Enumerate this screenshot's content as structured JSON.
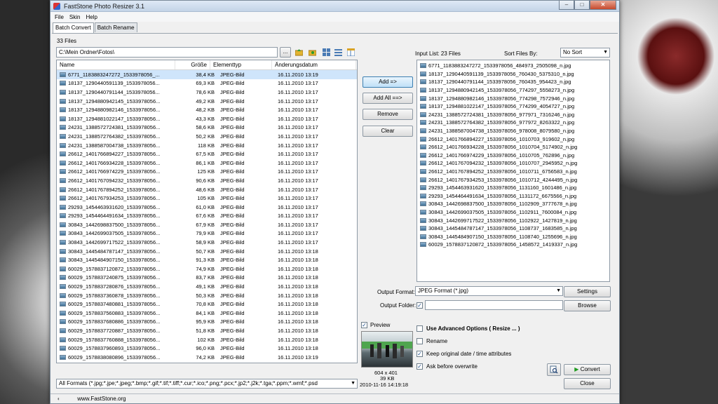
{
  "window": {
    "title": "FastStone Photo Resizer 3.1"
  },
  "menu": [
    "File",
    "Skin",
    "Help"
  ],
  "tabs": [
    "Batch Convert",
    "Batch Rename"
  ],
  "left": {
    "file_count": "33 Files",
    "path": "C:\\Mein Ordner\\Fotos\\",
    "browse_label": "...",
    "columns": [
      "Name",
      "Größe",
      "Elementtyp",
      "Änderungsdatum"
    ],
    "files": [
      [
        "6771_1183883247272_1533978056_...",
        "38,4 KB",
        "JPEG-Bild",
        "16.11.2010 13:19"
      ],
      [
        "18137_1290440591139_1533978056...",
        "69,3 KB",
        "JPEG-Bild",
        "16.11.2010 13:17"
      ],
      [
        "18137_1290440791144_1533978056...",
        "78,6 KB",
        "JPEG-Bild",
        "16.11.2010 13:17"
      ],
      [
        "18137_1294880942145_1533978056...",
        "49,2 KB",
        "JPEG-Bild",
        "16.11.2010 13:17"
      ],
      [
        "18137_1294880982146_1533978056...",
        "48,2 KB",
        "JPEG-Bild",
        "16.11.2010 13:17"
      ],
      [
        "18137_1294881022147_1533978056...",
        "43,3 KB",
        "JPEG-Bild",
        "16.11.2010 13:17"
      ],
      [
        "24231_1388572724381_1533978056...",
        "58,6 KB",
        "JPEG-Bild",
        "16.11.2010 13:17"
      ],
      [
        "24231_1388572764382_1533978056...",
        "50,2 KB",
        "JPEG-Bild",
        "16.11.2010 13:17"
      ],
      [
        "24231_1388587004738_1533978056...",
        "118 KB",
        "JPEG-Bild",
        "16.11.2010 13:17"
      ],
      [
        "26612_1401766894227_1533978056...",
        "67,5 KB",
        "JPEG-Bild",
        "16.11.2010 13:17"
      ],
      [
        "26612_1401766934228_1533978056...",
        "86,1 KB",
        "JPEG-Bild",
        "16.11.2010 13:17"
      ],
      [
        "26612_1401766974229_1533978056...",
        "125 KB",
        "JPEG-Bild",
        "16.11.2010 13:17"
      ],
      [
        "26612_1401767094232_1533978056...",
        "90,6 KB",
        "JPEG-Bild",
        "16.11.2010 13:17"
      ],
      [
        "26612_1401767894252_1533978056...",
        "48,6 KB",
        "JPEG-Bild",
        "16.11.2010 13:17"
      ],
      [
        "26612_1401767934253_1533978056...",
        "105 KB",
        "JPEG-Bild",
        "16.11.2010 13:17"
      ],
      [
        "29293_1454463931620_1533978056...",
        "61,0 KB",
        "JPEG-Bild",
        "16.11.2010 13:17"
      ],
      [
        "29293_1454464491634_1533978056...",
        "67,6 KB",
        "JPEG-Bild",
        "16.11.2010 13:17"
      ],
      [
        "30843_1442698837500_1533978056...",
        "67,9 KB",
        "JPEG-Bild",
        "16.11.2010 13:17"
      ],
      [
        "30843_1442699037505_1533978056...",
        "79,9 KB",
        "JPEG-Bild",
        "16.11.2010 13:17"
      ],
      [
        "30843_1442699717522_1533978056...",
        "58,9 KB",
        "JPEG-Bild",
        "16.11.2010 13:17"
      ],
      [
        "30843_1445484787147_1533978056...",
        "50,7 KB",
        "JPEG-Bild",
        "16.11.2010 13:18"
      ],
      [
        "30843_1445484907150_1533978056...",
        "91,3 KB",
        "JPEG-Bild",
        "16.11.2010 13:18"
      ],
      [
        "60029_1578837120872_1533978056...",
        "74,9 KB",
        "JPEG-Bild",
        "16.11.2010 13:18"
      ],
      [
        "60029_1578837240875_1533978056...",
        "83,7 KB",
        "JPEG-Bild",
        "16.11.2010 13:18"
      ],
      [
        "60029_1578837280876_1533978056...",
        "49,1 KB",
        "JPEG-Bild",
        "16.11.2010 13:18"
      ],
      [
        "60029_1578837360878_1533978056...",
        "50,3 KB",
        "JPEG-Bild",
        "16.11.2010 13:18"
      ],
      [
        "60029_1578837480881_1533978056...",
        "70,8 KB",
        "JPEG-Bild",
        "16.11.2010 13:18"
      ],
      [
        "60029_1578837560883_1533978056...",
        "84,1 KB",
        "JPEG-Bild",
        "16.11.2010 13:18"
      ],
      [
        "60029_1578837680886_1533978056...",
        "95,9 KB",
        "JPEG-Bild",
        "16.11.2010 13:18"
      ],
      [
        "60029_1578837720887_1533978056...",
        "51,8 KB",
        "JPEG-Bild",
        "16.11.2010 13:18"
      ],
      [
        "60029_1578837760888_1533978056...",
        "102 KB",
        "JPEG-Bild",
        "16.11.2010 13:18"
      ],
      [
        "60029_1578837960893_1533978056...",
        "96,0 KB",
        "JPEG-Bild",
        "16.11.2010 13:18"
      ],
      [
        "60029_1578838080896_1533978056...",
        "74,2 KB",
        "JPEG-Bild",
        "16.11.2010 13:19"
      ]
    ],
    "formats": "All Formats (*.jpg;*.jpe;*.jpeg;*.bmp;*.gif;*.tif;*.tiff;*.cur;*.ico;*.png;*.pcx;*.jp2;*.j2k;*.tga;*.ppm;*.wmf;*.psd"
  },
  "middle": {
    "add": "Add =>",
    "add_all": "Add All ==>",
    "remove": "Remove",
    "clear": "Clear"
  },
  "right": {
    "input_list": "Input List: 23 Files",
    "sort_label": "Sort Files By:",
    "sort_value": "No Sort",
    "items": [
      "6771_1183883247272_1533978056_484973_2505098_n.jpg",
      "18137_1290440591139_1533978056_760430_5375310_n.jpg",
      "18137_1290440791144_1533978056_760435_954423_n.jpg",
      "18137_1294880942145_1533978056_774297_5558273_n.jpg",
      "18137_1294880982146_1533978056_774298_7572946_n.jpg",
      "18137_1294881022147_1533978056_774299_4054727_n.jpg",
      "24231_1388572724381_1533978056_977971_7316246_n.jpg",
      "24231_1388572764382_1533978056_977972_8263322_n.jpg",
      "24231_1388587004738_1533978056_978008_8079580_n.jpg",
      "26612_1401766894227_1533978056_1010703_919602_n.jpg",
      "26612_1401766934228_1533978056_1010704_5174902_n.jpg",
      "26612_1401766974229_1533978056_1010705_762896_n.jpg",
      "26612_1401767094232_1533978056_1010707_2945952_n.jpg",
      "26612_1401767894252_1533978056_1010711_6756583_n.jpg",
      "26612_1401767934253_1533978056_1010712_4244495_n.jpg",
      "29293_1454463931620_1533978056_1131160_1601486_n.jpg",
      "29293_1454464491634_1533978056_1131172_6675566_n.jpg",
      "30843_1442698837500_1533978056_1102909_3777678_n.jpg",
      "30843_1442699037505_1533978056_1102911_7600084_n.jpg",
      "30843_1442699717522_1533978056_1102922_1427819_n.jpg",
      "30843_1445484787147_1533978056_1108737_1683585_n.jpg",
      "30843_1445484907150_1533978056_1108740_1255696_n.jpg",
      "60029_1578837120872_1533978056_1458572_1419337_n.jpg"
    ]
  },
  "output": {
    "format_label": "Output Format:",
    "format_value": "JPEG Format (*.jpg)",
    "settings": "Settings",
    "folder_label": "Output Folder:",
    "folder_value": "",
    "browse": "Browse"
  },
  "preview": {
    "label": "Preview",
    "dims": "604 x 401",
    "size": "39 KB",
    "date": "2010-11-16 14:19:18"
  },
  "options": {
    "advanced": "Use Advanced Options ( Resize ... )",
    "rename": "Rename",
    "keep_date": "Keep original date / time attributes",
    "ask": "Ask before overwrite"
  },
  "actions": {
    "convert": "Convert",
    "close": "Close"
  },
  "status": {
    "url": "www.FastStone.org"
  }
}
